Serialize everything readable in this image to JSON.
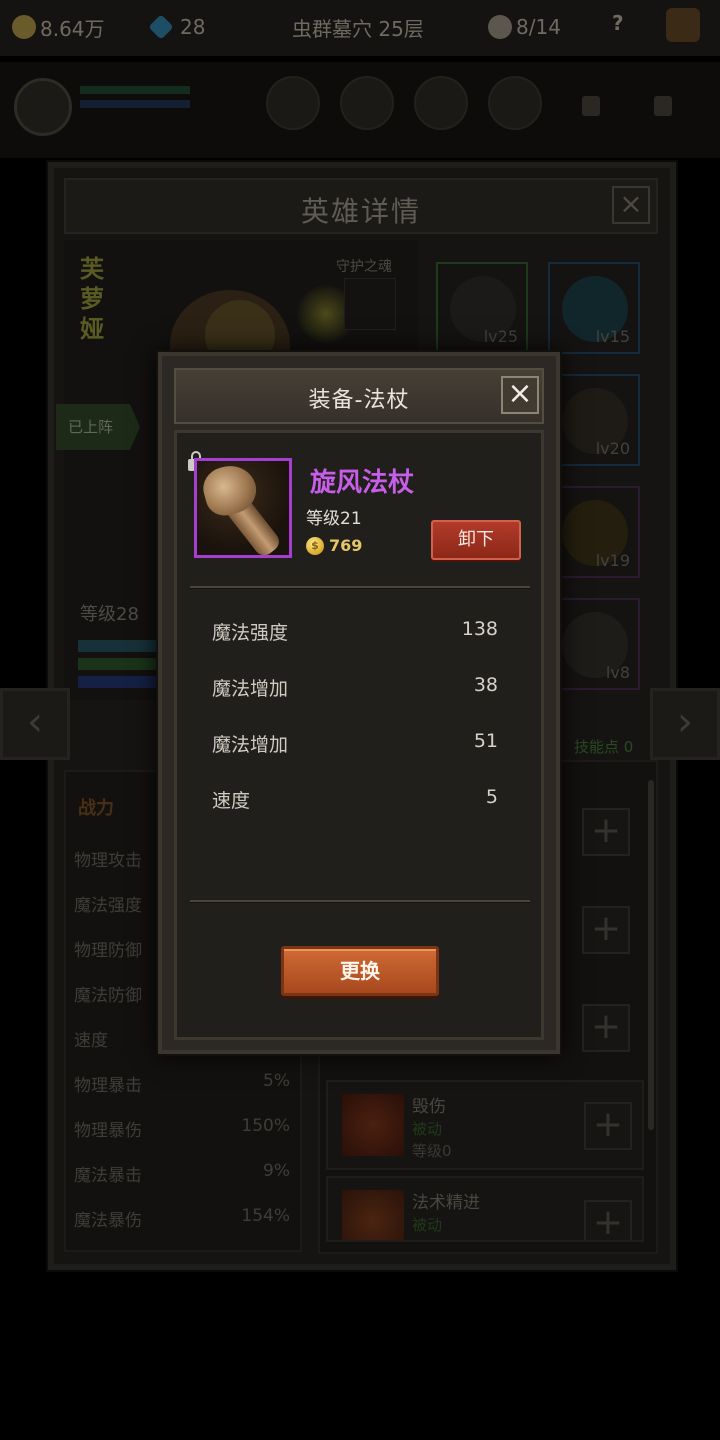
{
  "topbar": {
    "gold": "8.64万",
    "gems": "28",
    "stage": "虫群墓穴 25层",
    "skull_count": "8/14",
    "help": "?"
  },
  "hero_panel": {
    "title": "英雄详情",
    "close": "×",
    "hero_name": "芙萝娅",
    "guard_label": "守护之魂",
    "deployed_label": "已上阵",
    "level": "等级28",
    "skill_points": "技能点 0",
    "nav_left": "‹",
    "nav_right": "›",
    "equipment": [
      {
        "level": "lv25"
      },
      {
        "level": "lv15"
      },
      {
        "level": "lv20"
      },
      {
        "level": "lv19"
      },
      {
        "level": "lv8"
      }
    ],
    "stats_header": "战力",
    "stats": [
      {
        "label": "物理攻击",
        "value": ""
      },
      {
        "label": "魔法强度",
        "value": ""
      },
      {
        "label": "物理防御",
        "value": ""
      },
      {
        "label": "魔法防御",
        "value": ""
      },
      {
        "label": "速度",
        "value": ""
      },
      {
        "label": "物理暴击",
        "value": "5%"
      },
      {
        "label": "物理暴伤",
        "value": "150%"
      },
      {
        "label": "魔法暴击",
        "value": "9%"
      },
      {
        "label": "魔法暴伤",
        "value": "154%"
      }
    ],
    "skills": [
      {
        "name": "毁伤",
        "type": "被动",
        "level": "等级0"
      },
      {
        "name": "法术精进",
        "type": "被动",
        "level": ""
      }
    ],
    "plus": "+"
  },
  "modal": {
    "title": "装备-法杖",
    "close": "×",
    "item_name": "旋风法杖",
    "item_level": "等级21",
    "coin_symbol": "$",
    "price": "769",
    "unequip_label": "卸下",
    "attributes": [
      {
        "label": "魔法强度",
        "value": "138"
      },
      {
        "label": "魔法增加",
        "value": "38"
      },
      {
        "label": "魔法增加",
        "value": "51"
      },
      {
        "label": "速度",
        "value": "5"
      }
    ],
    "replace_label": "更换"
  },
  "colors": {
    "item_rarity": "#c65ee8",
    "unequip_button": "#b23a2a",
    "replace_button": "#d06a36",
    "price_gold": "#e5c765"
  }
}
